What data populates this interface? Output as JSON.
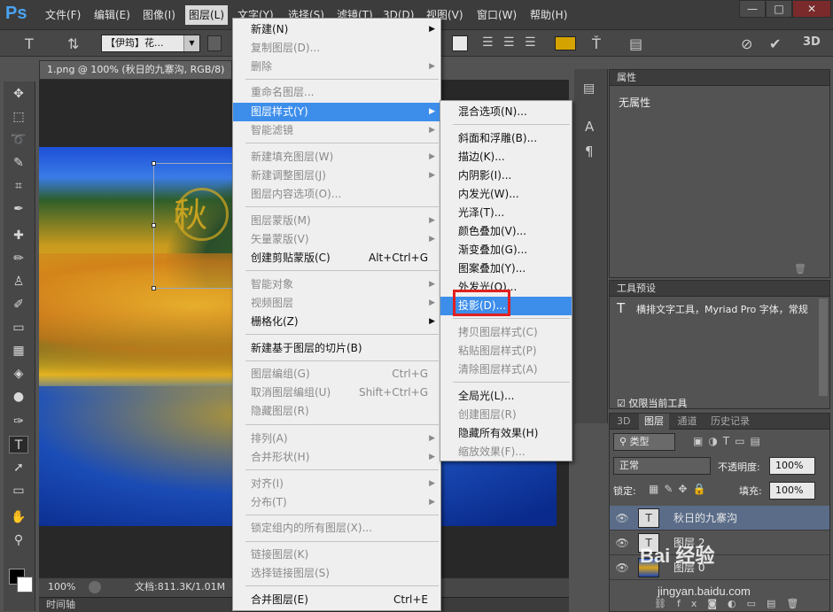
{
  "app": {
    "logo": "Ps"
  },
  "menubar": {
    "items": [
      "文件(F)",
      "编辑(E)",
      "图像(I)",
      "图层(L)",
      "文字(Y)",
      "选择(S)",
      "滤镜(T)",
      "3D(D)",
      "视图(V)",
      "窗口(W)",
      "帮助(H)"
    ],
    "active": "图层(L)"
  },
  "window_controls": {
    "minimize": "—",
    "restore": "□",
    "close": "✕"
  },
  "optionsbar": {
    "font_family": "【伊筠】花...",
    "three_d": "3D",
    "accent_color": "#d4a300"
  },
  "document": {
    "tab_title": "1.png @ 100% (秋日的九寨沟, RGB/8)",
    "canvas_text": "秋",
    "zoom": "100%",
    "doc_info": "文档:811.3K/1.01M",
    "timeline_label": "时间轴"
  },
  "layer_menu": {
    "items": [
      {
        "label": "新建(N)",
        "sub": true
      },
      {
        "label": "复制图层(D)...",
        "disabled": true
      },
      {
        "label": "删除",
        "disabled": true,
        "sub": true
      },
      {
        "label": "重命名图层...",
        "disabled": true
      },
      {
        "label": "图层样式(Y)",
        "highlighted": true,
        "sub": true
      },
      {
        "label": "智能滤镜",
        "disabled": true,
        "sub": true
      },
      {
        "label": "新建填充图层(W)",
        "disabled": true,
        "sub": true
      },
      {
        "label": "新建调整图层(J)",
        "disabled": true,
        "sub": true
      },
      {
        "label": "图层内容选项(O)...",
        "disabled": true
      },
      {
        "label": "图层蒙版(M)",
        "disabled": true,
        "sub": true
      },
      {
        "label": "矢量蒙版(V)",
        "disabled": true,
        "sub": true
      },
      {
        "label": "创建剪贴蒙版(C)",
        "shortcut": "Alt+Ctrl+G"
      },
      {
        "label": "智能对象",
        "disabled": true,
        "sub": true
      },
      {
        "label": "视频图层",
        "disabled": true,
        "sub": true
      },
      {
        "label": "栅格化(Z)",
        "sub": true
      },
      {
        "label": "新建基于图层的切片(B)"
      },
      {
        "label": "图层编组(G)",
        "disabled": true,
        "shortcut": "Ctrl+G"
      },
      {
        "label": "取消图层编组(U)",
        "disabled": true,
        "shortcut": "Shift+Ctrl+G"
      },
      {
        "label": "隐藏图层(R)",
        "disabled": true
      },
      {
        "label": "排列(A)",
        "disabled": true,
        "sub": true
      },
      {
        "label": "合并形状(H)",
        "disabled": true,
        "sub": true
      },
      {
        "label": "对齐(I)",
        "disabled": true,
        "sub": true
      },
      {
        "label": "分布(T)",
        "disabled": true,
        "sub": true
      },
      {
        "label": "锁定组内的所有图层(X)...",
        "disabled": true
      },
      {
        "label": "链接图层(K)",
        "disabled": true
      },
      {
        "label": "选择链接图层(S)",
        "disabled": true
      },
      {
        "label": "合并图层(E)",
        "shortcut": "Ctrl+E"
      }
    ]
  },
  "style_submenu": {
    "items": [
      {
        "label": "混合选项(N)..."
      },
      {
        "label": "斜面和浮雕(B)..."
      },
      {
        "label": "描边(K)..."
      },
      {
        "label": "内阴影(I)..."
      },
      {
        "label": "内发光(W)..."
      },
      {
        "label": "光泽(T)..."
      },
      {
        "label": "颜色叠加(V)..."
      },
      {
        "label": "渐变叠加(G)..."
      },
      {
        "label": "图案叠加(Y)..."
      },
      {
        "label": "外发光(O)..."
      },
      {
        "label": "投影(D)...",
        "highlighted": true
      },
      {
        "label": "拷贝图层样式(C)",
        "disabled": true
      },
      {
        "label": "粘贴图层样式(P)",
        "disabled": true
      },
      {
        "label": "清除图层样式(A)",
        "disabled": true
      },
      {
        "label": "全局光(L)..."
      },
      {
        "label": "创建图层(R)",
        "disabled": true
      },
      {
        "label": "隐藏所有效果(H)"
      },
      {
        "label": "缩放效果(F)...",
        "disabled": true
      }
    ]
  },
  "properties_panel": {
    "title": "属性",
    "empty_text": "无属性"
  },
  "tool_presets_panel": {
    "title": "工具预设",
    "preset": "横排文字工具，Myriad Pro 字体，常规",
    "current_only": "仅限当前工具"
  },
  "layers_panel": {
    "tabs": [
      "3D",
      "图层",
      "通道",
      "历史记录"
    ],
    "active_tab": "图层",
    "filter_kind": "类型",
    "blend_mode": "正常",
    "opacity_label": "不透明度:",
    "opacity": "100%",
    "lock_label": "锁定:",
    "fill_label": "填充:",
    "fill": "100%",
    "layers": [
      {
        "name": "秋日的九寨沟",
        "type": "text",
        "selected": true
      },
      {
        "name": "图层 2",
        "type": "text"
      },
      {
        "name": "图层 0",
        "type": "image"
      }
    ]
  },
  "watermark": {
    "main": "Bai 经验",
    "sub": "jingyan.baidu.com"
  }
}
